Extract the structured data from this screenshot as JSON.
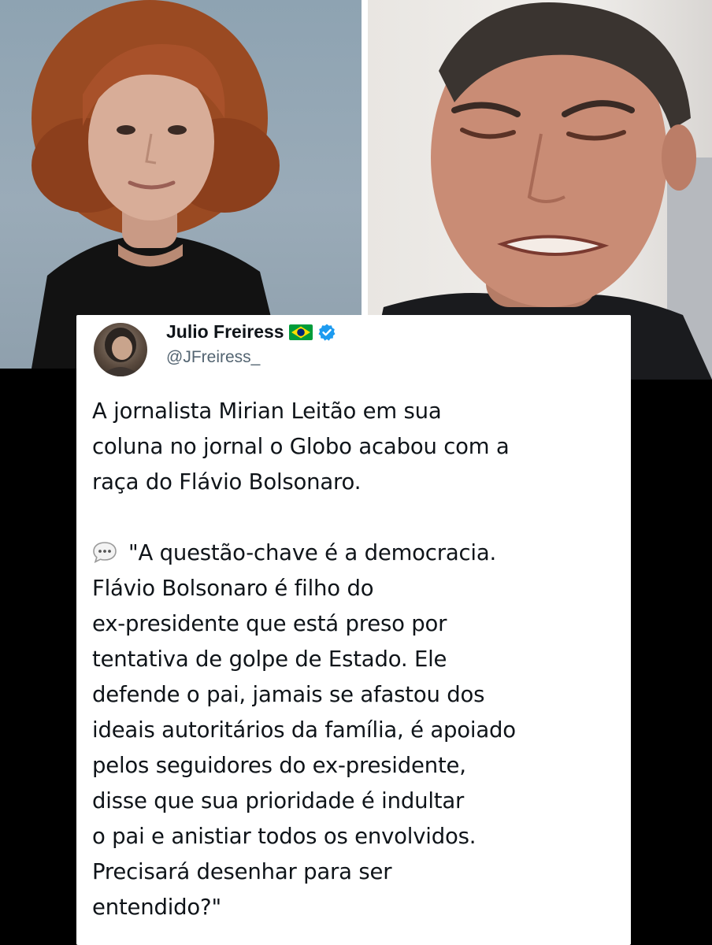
{
  "tweet": {
    "display_name": "Julio Freiress",
    "handle": "@JFreiress_",
    "paragraph1_lines": [
      "A jornalista Mirian Leitão em sua",
      "coluna no jornal o Globo acabou com a",
      "raça do Flávio Bolsonaro."
    ],
    "paragraph2_lines": [
      "\"A questão-chave é a democracia.",
      "Flávio Bolsonaro é filho do",
      "ex-presidente que está preso por",
      "tentativa de golpe de Estado. Ele",
      "defende o pai, jamais se afastou dos",
      "ideais autoritários da família, é apoiado",
      "pelos seguidores do ex-presidente,",
      "disse que sua prioridade é indultar",
      "o pai e anistiar todos os envolvidos.",
      "Precisará desenhar para ser",
      "entendido?\""
    ]
  },
  "icons": {
    "flag": "brazil-flag-icon",
    "verified": "verified-badge-icon",
    "speech": "speech-bubble-icon"
  },
  "colors": {
    "verified_blue": "#1d9bf0",
    "text_primary": "#0f1419",
    "text_secondary": "#536471",
    "background": "#000000",
    "card": "#ffffff"
  }
}
